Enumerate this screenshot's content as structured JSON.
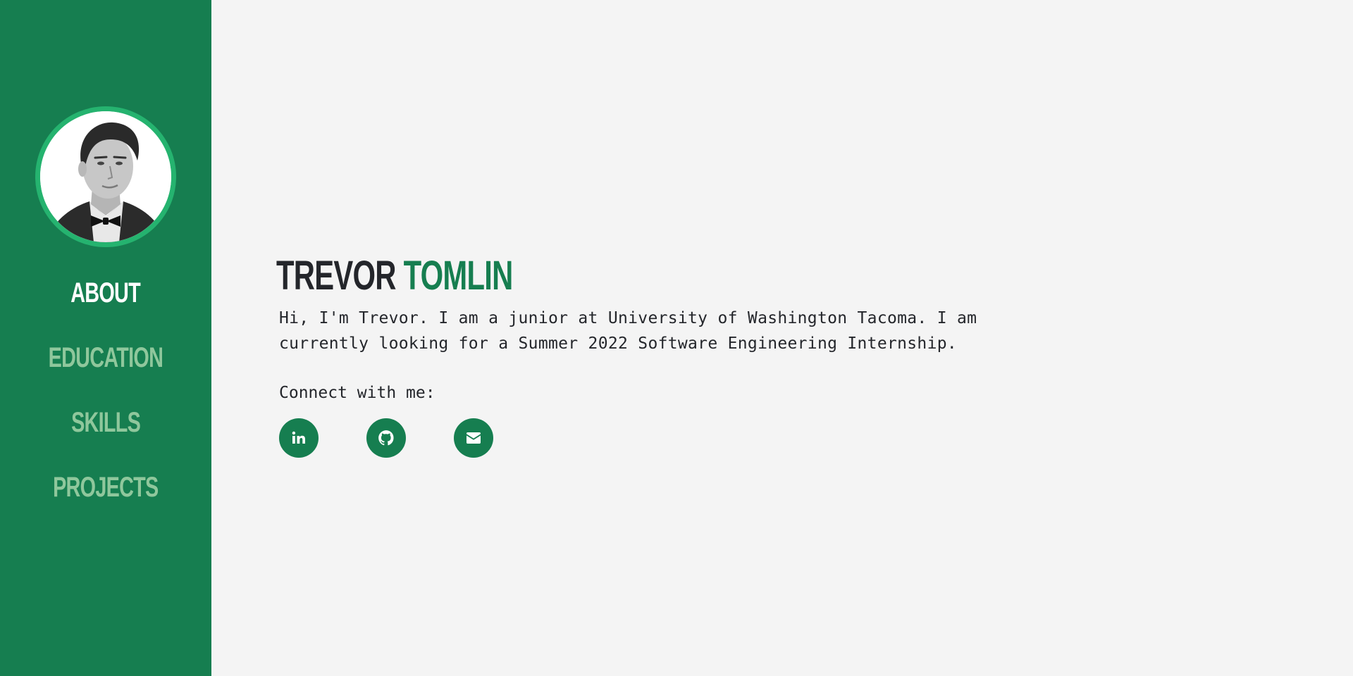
{
  "sidebar": {
    "avatar_alt": "Trevor Tomlin",
    "nav": [
      {
        "label": "About",
        "active": true
      },
      {
        "label": "Education",
        "active": false
      },
      {
        "label": "Skills",
        "active": false
      },
      {
        "label": "Projects",
        "active": false
      }
    ]
  },
  "main": {
    "first_name": "Trevor",
    "last_name": "Tomlin",
    "bio": "Hi, I'm Trevor. I am a junior at University of Washington Tacoma. I am currently looking for a Summer 2022 Software Engineering Internship.",
    "connect_label": "Connect with me:",
    "socials": [
      {
        "icon": "linkedin-icon"
      },
      {
        "icon": "github-icon"
      },
      {
        "icon": "envelope-icon"
      }
    ]
  },
  "colors": {
    "sidebar_bg": "#167e50",
    "accent": "#167e50",
    "ring": "#25b36f",
    "nav_inactive": "#8fc79c",
    "nav_active": "#ffffff",
    "page_bg": "#f4f4f4",
    "text": "#24262b"
  }
}
